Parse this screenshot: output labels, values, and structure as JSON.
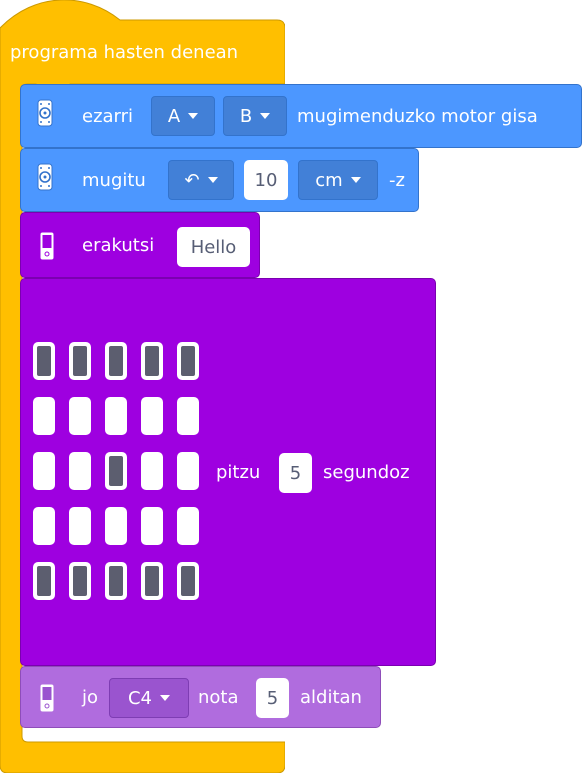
{
  "hat": {
    "label": "programa hasten denean"
  },
  "motor_setup": {
    "label_prefix": "ezarri",
    "port_a": "A",
    "port_b": "B",
    "label_suffix": "mugimenduzko motor gisa"
  },
  "move": {
    "label_prefix": "mugitu",
    "direction": "↶",
    "distance": "10",
    "unit": "cm",
    "label_suffix": "-z"
  },
  "show_text": {
    "label": "erakutsi",
    "value": "Hello"
  },
  "light_matrix": {
    "pixels": [
      [
        1,
        1,
        1,
        1,
        1
      ],
      [
        0,
        0,
        0,
        0,
        0
      ],
      [
        0,
        0,
        1,
        0,
        0
      ],
      [
        0,
        0,
        0,
        0,
        0
      ],
      [
        1,
        1,
        1,
        1,
        1
      ]
    ],
    "label_prefix": "pitzu",
    "seconds": "5",
    "label_suffix": "segundoz"
  },
  "play_note": {
    "label_prefix": "jo",
    "note": "C4",
    "label_mid": "nota",
    "beats": "5",
    "label_suffix": "alditan"
  },
  "colors": {
    "hat": "#FFBF00",
    "motors": "#4C97FF",
    "display": "#9E00E0",
    "sound": "#B06CDE"
  }
}
